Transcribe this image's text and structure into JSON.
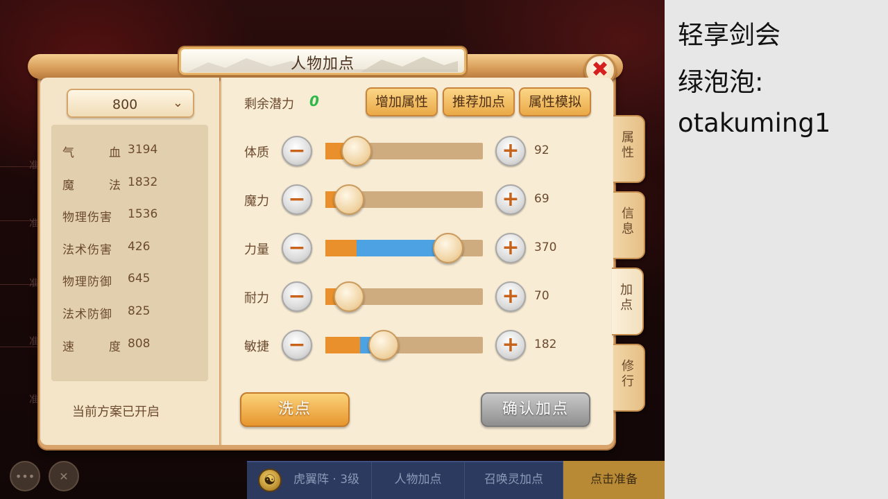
{
  "dialog": {
    "title": "人物加点",
    "close_icon": "close-x-icon"
  },
  "plan_selector": {
    "value": "800",
    "icon": "chevron-down-icon"
  },
  "stats": [
    {
      "label_a": "气",
      "label_b": "血",
      "value": "3194"
    },
    {
      "label_a": "魔",
      "label_b": "法",
      "value": "1832"
    },
    {
      "label": "物理伤害",
      "value": "1536"
    },
    {
      "label": "法术伤害",
      "value": "426"
    },
    {
      "label": "物理防御",
      "value": "645"
    },
    {
      "label": "法术防御",
      "value": "825"
    },
    {
      "label_a": "速",
      "label_b": "度",
      "value": "808"
    }
  ],
  "scheme_note": "当前方案已开启",
  "potential": {
    "label": "剩余潜力",
    "value": "0"
  },
  "toolbar": {
    "add_attr": "增加属性",
    "recommend": "推荐加点",
    "simulate": "属性模拟"
  },
  "attributes": [
    {
      "label": "体质",
      "value": "92",
      "base_fraction": 0.2,
      "added_fraction": 0.0
    },
    {
      "label": "魔力",
      "value": "69",
      "base_fraction": 0.15,
      "added_fraction": 0.0
    },
    {
      "label": "力量",
      "value": "370",
      "base_fraction": 0.2,
      "added_fraction": 0.58
    },
    {
      "label": "耐力",
      "value": "70",
      "base_fraction": 0.15,
      "added_fraction": 0.0
    },
    {
      "label": "敏捷",
      "value": "182",
      "base_fraction": 0.22,
      "added_fraction": 0.15
    }
  ],
  "buttons": {
    "wash": "洗点",
    "confirm": "确认加点"
  },
  "side_tabs": [
    {
      "label": "属性",
      "active": false
    },
    {
      "label": "信息",
      "active": false
    },
    {
      "label": "加点",
      "active": true
    },
    {
      "label": "修行",
      "active": false
    }
  ],
  "bottom_bar": {
    "formation": "虎翼阵 · 3级",
    "char_points": "人物加点",
    "summon_points": "召唤灵加点",
    "ready": "点击准备",
    "formation_icon": "tiger-emblem-icon"
  },
  "bg_labels": [
    "准",
    "准",
    "准",
    "准",
    "准"
  ],
  "overlay": {
    "line1": "轻享剑会",
    "line2": "绿泡泡:",
    "line3": "otakuming1"
  },
  "colors": {
    "accent_orange": "#e9902c",
    "accent_blue": "#4da2e4",
    "potential_green": "#2fb84a",
    "close_red": "#d61f1f"
  }
}
